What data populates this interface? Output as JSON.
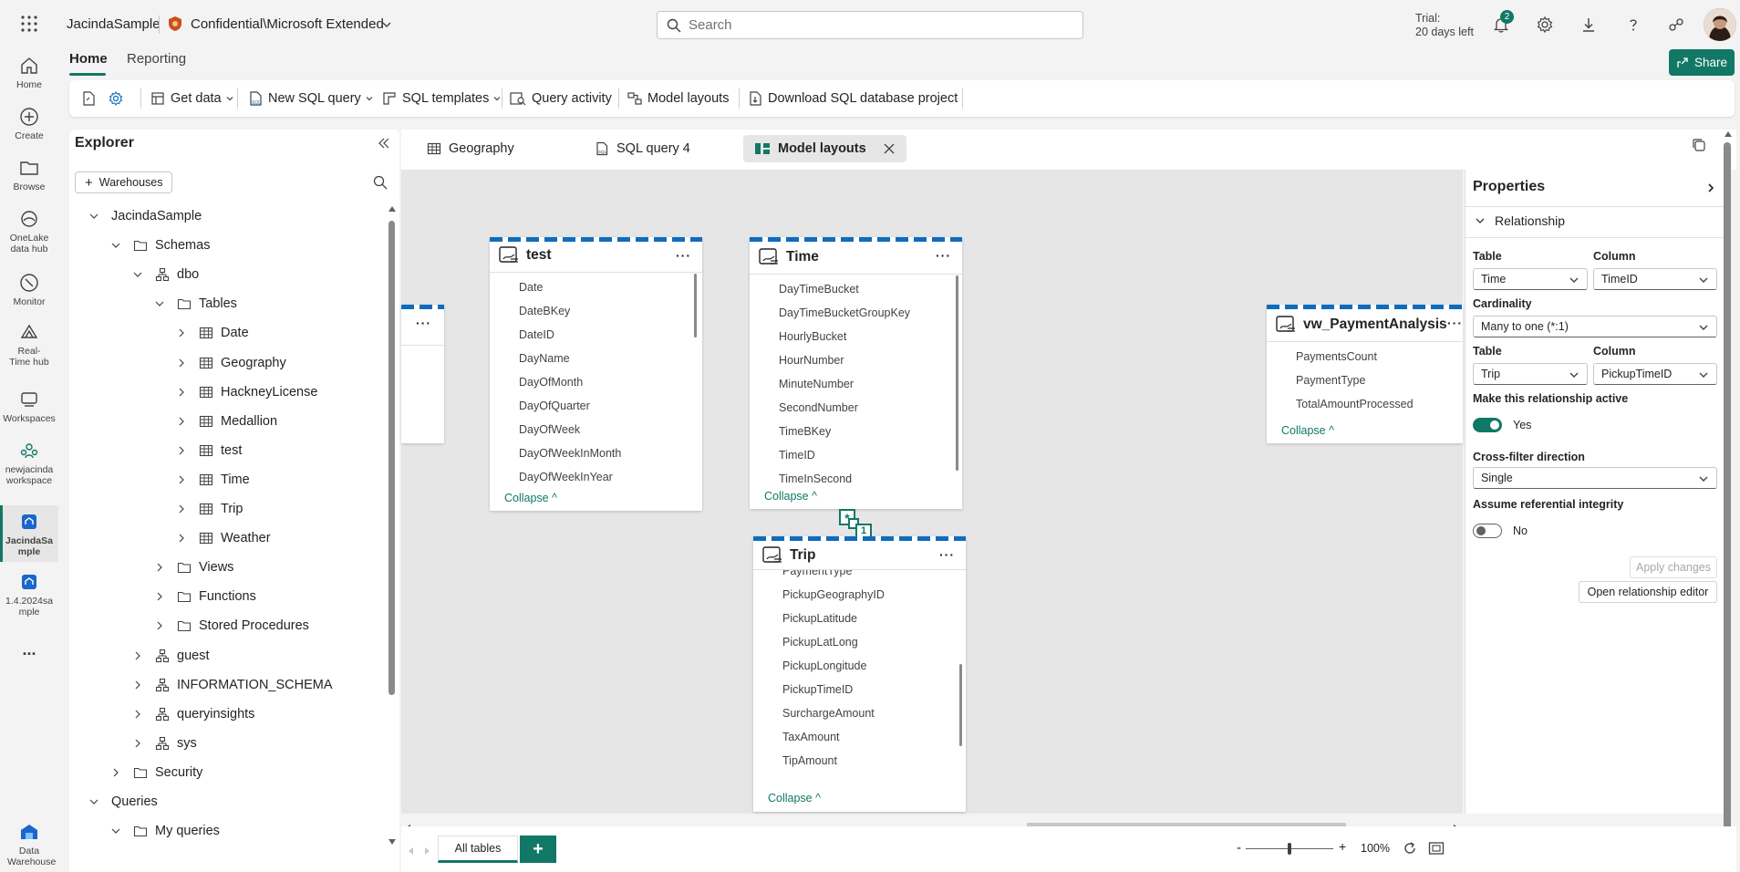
{
  "header": {
    "workspace": "JacindaSample",
    "sensitivity": "Confidential\\Microsoft Extended",
    "search_placeholder": "Search",
    "trial_line1": "Trial:",
    "trial_line2": "20 days left",
    "notification_count": "2",
    "share_label": "Share"
  },
  "rail": {
    "items": [
      {
        "label": "Home"
      },
      {
        "label": "Create"
      },
      {
        "label": "Browse"
      },
      {
        "label": "OneLake data hub"
      },
      {
        "label": "Monitor"
      },
      {
        "label": "Real-Time hub"
      },
      {
        "label": "Workspaces"
      },
      {
        "label": "newjacinda workspace"
      },
      {
        "label": "JacindaSample"
      },
      {
        "label": "1.4.2024sample"
      },
      {
        "label": "Data Warehouse"
      }
    ],
    "more": "..."
  },
  "ribbon": {
    "tabs": [
      "Home",
      "Reporting"
    ],
    "buttons": {
      "get_data": "Get data",
      "new_sql_query": "New SQL query",
      "sql_templates": "SQL templates",
      "query_activity": "Query activity",
      "model_layouts": "Model layouts",
      "download_project": "Download SQL database project"
    }
  },
  "explorer": {
    "title": "Explorer",
    "warehouses_button": "Warehouses",
    "tree": [
      {
        "label": "JacindaSample"
      },
      {
        "label": "Schemas"
      },
      {
        "label": "dbo"
      },
      {
        "label": "Tables"
      },
      {
        "label": "Date"
      },
      {
        "label": "Geography"
      },
      {
        "label": "HackneyLicense"
      },
      {
        "label": "Medallion"
      },
      {
        "label": "test"
      },
      {
        "label": "Time"
      },
      {
        "label": "Trip"
      },
      {
        "label": "Weather"
      },
      {
        "label": "Views"
      },
      {
        "label": "Functions"
      },
      {
        "label": "Stored Procedures"
      },
      {
        "label": "guest"
      },
      {
        "label": "INFORMATION_SCHEMA"
      },
      {
        "label": "queryinsights"
      },
      {
        "label": "sys"
      },
      {
        "label": "Security"
      },
      {
        "label": "Queries"
      },
      {
        "label": "My queries"
      }
    ]
  },
  "doc_tabs": [
    {
      "label": "Geography"
    },
    {
      "label": "SQL query 4"
    },
    {
      "label": "Model layouts"
    }
  ],
  "cards": {
    "collapse_label": "Collapse",
    "more_label": "···",
    "test": {
      "title": "test",
      "columns": [
        "Date",
        "DateBKey",
        "DateID",
        "DayName",
        "DayOfMonth",
        "DayOfQuarter",
        "DayOfWeek",
        "DayOfWeekInMonth",
        "DayOfWeekInYear"
      ]
    },
    "time": {
      "title": "Time",
      "columns": [
        "DayTimeBucket",
        "DayTimeBucketGroupKey",
        "HourlyBucket",
        "HourNumber",
        "MinuteNumber",
        "SecondNumber",
        "TimeBKey",
        "TimeID",
        "TimeInSecond"
      ]
    },
    "trip": {
      "title": "Trip",
      "columns": [
        "PaymentType",
        "PickupGeographyID",
        "PickupLatitude",
        "PickupLatLong",
        "PickupLongitude",
        "PickupTimeID",
        "SurchargeAmount",
        "TaxAmount",
        "TipAmount"
      ]
    },
    "payment": {
      "title": "vw_PaymentAnalysis",
      "columns": [
        "PaymentsCount",
        "PaymentType",
        "TotalAmountProcessed"
      ]
    },
    "relationship": {
      "many": "*",
      "one": "1"
    }
  },
  "properties": {
    "title": "Properties",
    "section": "Relationship",
    "table_label": "Table",
    "column_label": "Column",
    "table1": "Time",
    "column1": "TimeID",
    "cardinality_label": "Cardinality",
    "cardinality": "Many to one (*:1)",
    "table2": "Trip",
    "column2": "PickupTimeID",
    "active_label": "Make this relationship active",
    "active_value": "Yes",
    "crossfilter_label": "Cross-filter direction",
    "crossfilter": "Single",
    "integrity_label": "Assume referential integrity",
    "integrity_value": "No",
    "apply_button": "Apply changes",
    "open_editor_button": "Open relationship editor"
  },
  "bottom": {
    "tab_label": "All tables",
    "add_label": "+",
    "zoom_minus": "-",
    "zoom_plus": "+",
    "zoom": "100%",
    "zoom_fraction": 0.5
  },
  "colors": {
    "accent": "#117865",
    "dash": "#0f6cbd"
  }
}
